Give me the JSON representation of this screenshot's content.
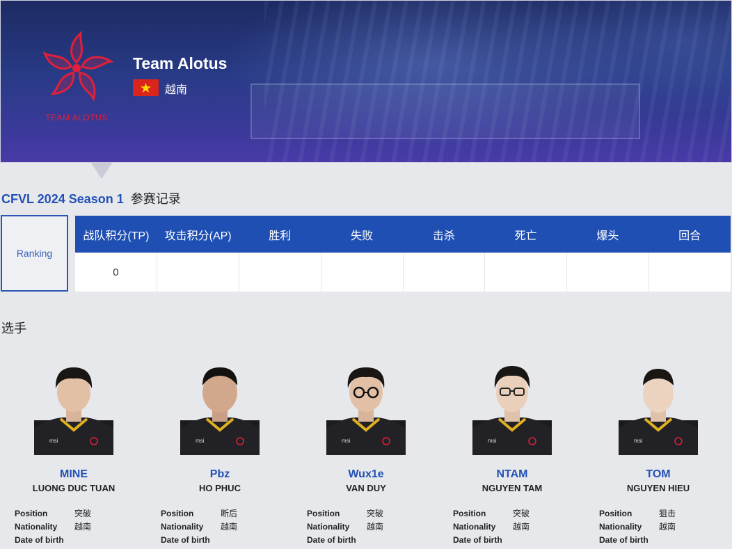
{
  "team": {
    "name": "Team Alotus",
    "country": "越南",
    "logo_text": "TEAM ALOTUS",
    "brand_color": "#e0203a"
  },
  "season": {
    "name": "CFVL 2024 Season 1",
    "subtitle": "参赛记录",
    "ranking_label": "Ranking",
    "columns": [
      "战队积分(TP)",
      "攻击积分(AP)",
      "胜利",
      "失败",
      "击杀",
      "死亡",
      "爆头",
      "回合"
    ],
    "values": [
      "0",
      "",
      "",
      "",
      "",
      "",
      "",
      ""
    ],
    "accent": "#1f4fb3"
  },
  "players_section": {
    "title": "选手"
  },
  "labels": {
    "position": "Position",
    "nationality": "Nationality",
    "dob": "Date of birth"
  },
  "players": [
    {
      "nick": "MINE",
      "real": "LUONG DUC TUAN",
      "position": "突破",
      "nationality": "越南",
      "dob": ""
    },
    {
      "nick": "Pbz",
      "real": "HO PHUC",
      "position": "断后",
      "nationality": "越南",
      "dob": ""
    },
    {
      "nick": "Wux1e",
      "real": "VAN DUY",
      "position": "突破",
      "nationality": "越南",
      "dob": ""
    },
    {
      "nick": "NTAM",
      "real": "NGUYEN TAM",
      "position": "突破",
      "nationality": "越南",
      "dob": ""
    },
    {
      "nick": "TOM",
      "real": "NGUYEN HIEU",
      "position": "狙击",
      "nationality": "越南",
      "dob": ""
    }
  ]
}
